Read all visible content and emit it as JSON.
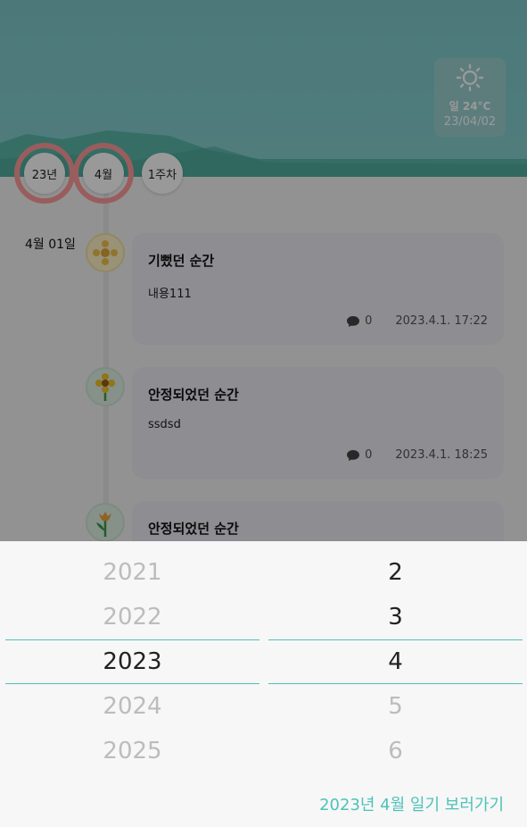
{
  "header": {
    "weather": {
      "icon": "sun-icon",
      "temperature": "일 24°C",
      "date": "23/04/02"
    }
  },
  "period_nav": {
    "year_label": "23년",
    "month_label": "4월",
    "week_label": "1주차"
  },
  "timeline": {
    "date_label": "4월 01일",
    "entries": [
      {
        "icon": "ornament-flower-icon",
        "title": "기뻤던 순간",
        "body": "내용111",
        "comment_count": "0",
        "datetime": "2023.4.1. 17:22"
      },
      {
        "icon": "sunflower-icon",
        "title": "안정되었던 순간",
        "body": "ssdsd",
        "comment_count": "0",
        "datetime": "2023.4.1. 18:25"
      },
      {
        "icon": "tulip-icon",
        "title": "안정되었던 순간"
      }
    ]
  },
  "picker": {
    "years": [
      "2021",
      "2022",
      "2023",
      "2024",
      "2025"
    ],
    "months": [
      "2",
      "3",
      "4",
      "5",
      "6"
    ],
    "selected_year": "2023",
    "selected_month": "4",
    "confirm_label": "2023년 4월 일기 보러가기"
  },
  "colors": {
    "accent": "#4cc3b8",
    "highlight_ring": "#ff9c9c",
    "header_sky": "#86d0d0",
    "mountain": "#5ab8a8"
  }
}
